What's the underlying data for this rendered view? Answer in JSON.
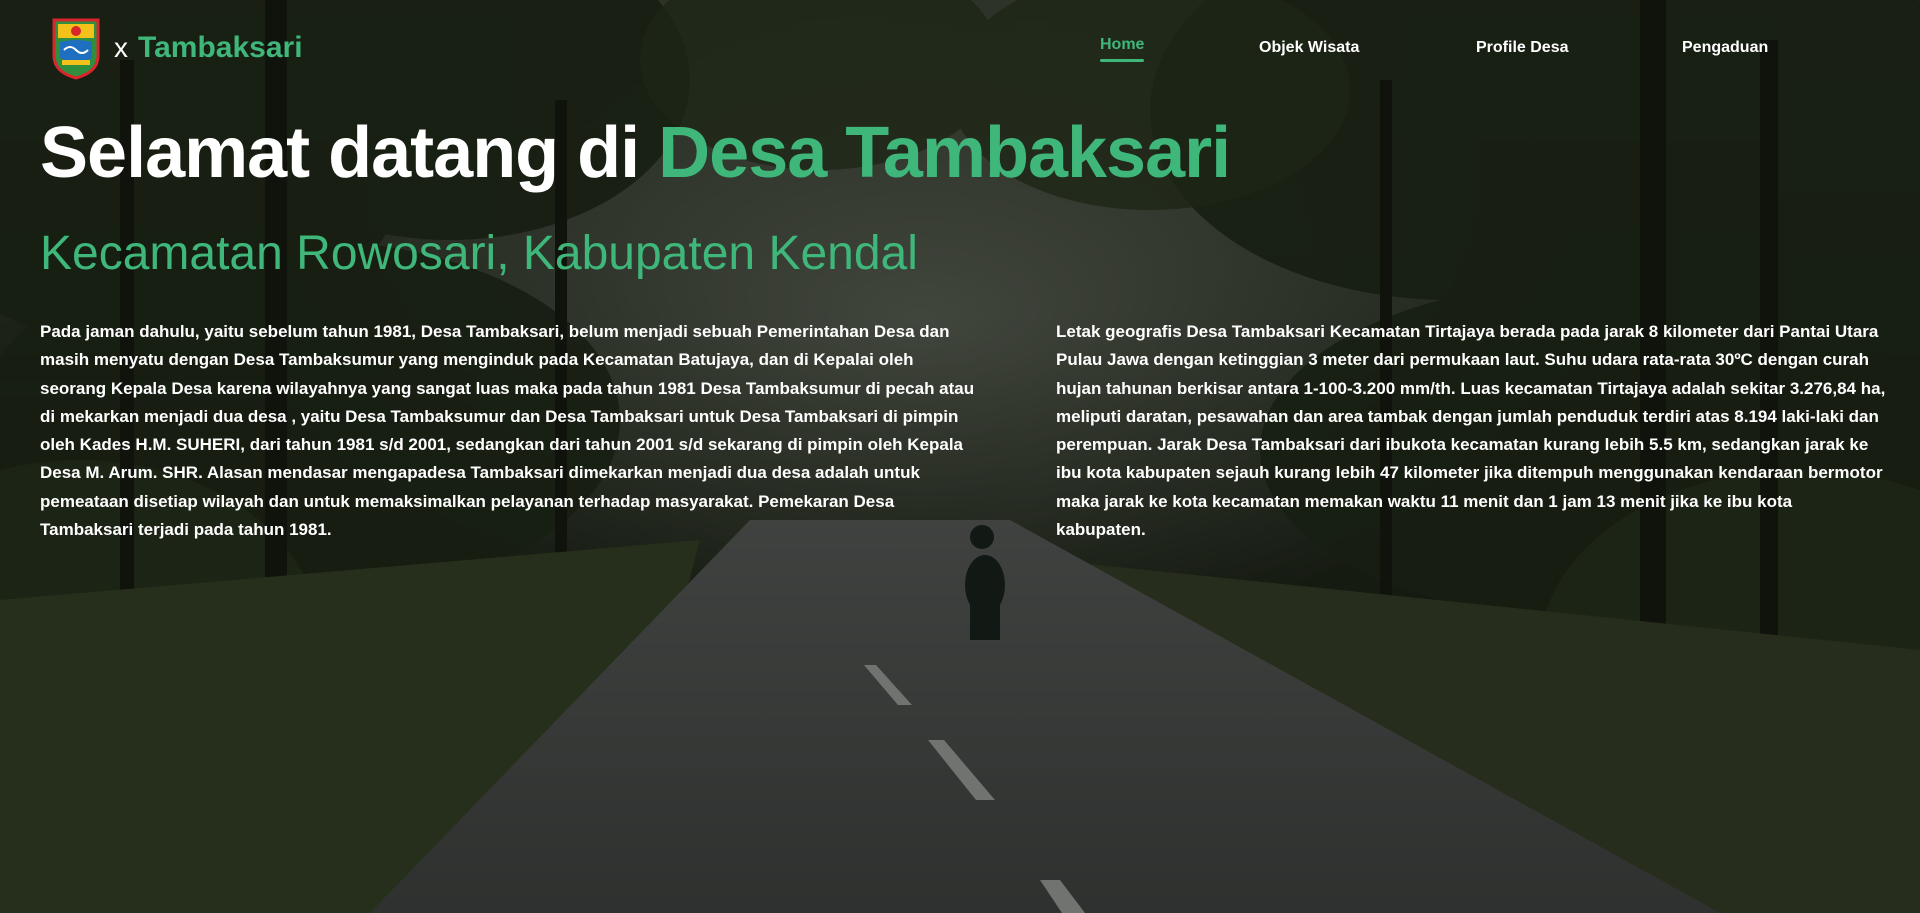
{
  "brand": {
    "separator": "x",
    "name": "Tambaksari"
  },
  "nav": {
    "items": [
      {
        "label": "Home",
        "active": true
      },
      {
        "label": "Objek Wisata",
        "active": false
      },
      {
        "label": "Profile Desa",
        "active": false
      },
      {
        "label": "Pengaduan",
        "active": false
      }
    ]
  },
  "hero": {
    "title_lead": "Selamat datang di ",
    "title_accent": "Desa Tambaksari",
    "subtitle": "Kecamatan Rowosari, Kabupaten Kendal",
    "paragraph_left": "Pada jaman dahulu, yaitu sebelum tahun 1981, Desa Tambaksari, belum menjadi sebuah Pemerintahan Desa dan masih menyatu dengan Desa Tambaksumur yang menginduk pada Kecamatan Batujaya, dan di Kepalai oleh seorang Kepala Desa karena wilayahnya yang sangat luas maka pada tahun 1981 Desa Tambaksumur di pecah atau di mekarkan menjadi dua desa , yaitu Desa Tambaksumur dan Desa Tambaksari untuk Desa Tambaksari di pimpin oleh Kades H.M. SUHERI, dari tahun 1981 s/d 2001, sedangkan dari tahun 2001 s/d sekarang di pimpin oleh Kepala Desa M. Arum. SHR. Alasan mendasar mengapadesa Tambaksari dimekarkan menjadi dua desa adalah untuk pemeataan disetiap wilayah dan untuk memaksimalkan pelayanan terhadap masyarakat. Pemekaran Desa Tambaksari terjadi pada tahun 1981.",
    "paragraph_right": "Letak geografis Desa Tambaksari Kecamatan Tirtajaya berada pada jarak 8 kilometer dari Pantai Utara Pulau Jawa dengan ketinggian 3 meter dari permukaan laut. Suhu udara rata-rata 30ºC dengan curah hujan tahunan berkisar antara 1-100-3.200 mm/th. Luas kecamatan Tirtajaya adalah sekitar 3.276,84 ha, meliputi daratan, pesawahan dan area tambak dengan jumlah penduduk terdiri atas 8.194 laki-laki dan perempuan. Jarak Desa Tambaksari dari ibukota kecamatan kurang lebih 5.5 km, sedangkan jarak ke ibu kota kabupaten sejauh kurang lebih 47 kilometer jika ditempuh menggunakan kendaraan bermotor maka jarak ke kota kecamatan memakan waktu 11 menit dan 1 jam 13 menit jika ke ibu kota kabupaten."
  },
  "colors": {
    "accent": "#3fb67a",
    "text": "#ffffff",
    "overlay": "#000000"
  },
  "icons": {
    "logo": "kendal-regency-emblem-icon"
  }
}
